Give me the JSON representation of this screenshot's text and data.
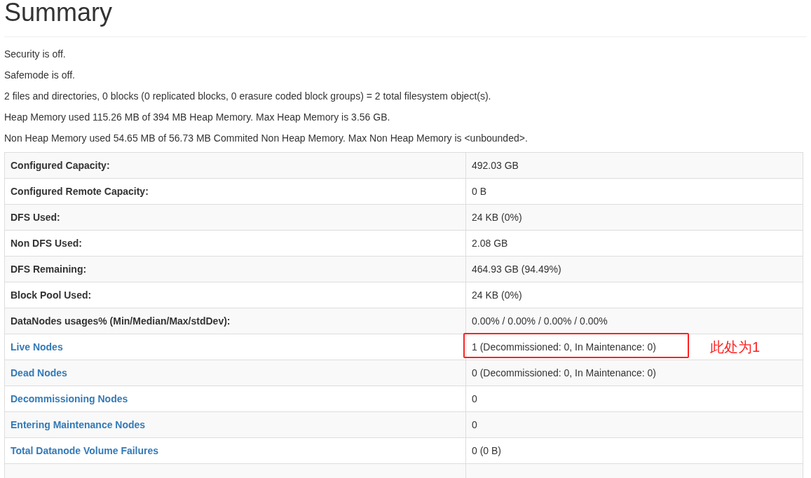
{
  "title": "Summary",
  "lines": [
    "Security is off.",
    "Safemode is off.",
    "2 files and directories, 0 blocks (0 replicated blocks, 0 erasure coded block groups) = 2 total filesystem object(s).",
    "Heap Memory used 115.26 MB of 394 MB Heap Memory. Max Heap Memory is 3.56 GB.",
    "Non Heap Memory used 54.65 MB of 56.73 MB Commited Non Heap Memory. Max Non Heap Memory is <unbounded>."
  ],
  "table": {
    "rows": [
      {
        "kind": "text",
        "label": "Configured Capacity:",
        "value": "492.03 GB",
        "highlighted": false
      },
      {
        "kind": "text",
        "label": "Configured Remote Capacity:",
        "value": "0 B",
        "highlighted": false
      },
      {
        "kind": "text",
        "label": "DFS Used:",
        "value": "24 KB (0%)",
        "highlighted": false
      },
      {
        "kind": "text",
        "label": "Non DFS Used:",
        "value": "2.08 GB",
        "highlighted": false
      },
      {
        "kind": "text",
        "label": "DFS Remaining:",
        "value": "464.93 GB (94.49%)",
        "highlighted": false
      },
      {
        "kind": "text",
        "label": "Block Pool Used:",
        "value": "24 KB (0%)",
        "highlighted": false
      },
      {
        "kind": "text",
        "label": "DataNodes usages% (Min/Median/Max/stdDev):",
        "value": "0.00% / 0.00% / 0.00% / 0.00%",
        "highlighted": false
      },
      {
        "kind": "link",
        "label": "Live Nodes",
        "value": "1 (Decommissioned: 0, In Maintenance: 0)",
        "highlighted": true,
        "note": "此处为1"
      },
      {
        "kind": "link",
        "label": "Dead Nodes",
        "value": "0 (Decommissioned: 0, In Maintenance: 0)",
        "highlighted": false
      },
      {
        "kind": "link",
        "label": "Decommissioning Nodes",
        "value": "0",
        "highlighted": false
      },
      {
        "kind": "link",
        "label": "Entering Maintenance Nodes",
        "value": "0",
        "highlighted": false
      },
      {
        "kind": "link",
        "label": "Total Datanode Volume Failures",
        "value": "0 (0 B)",
        "highlighted": false
      }
    ]
  }
}
